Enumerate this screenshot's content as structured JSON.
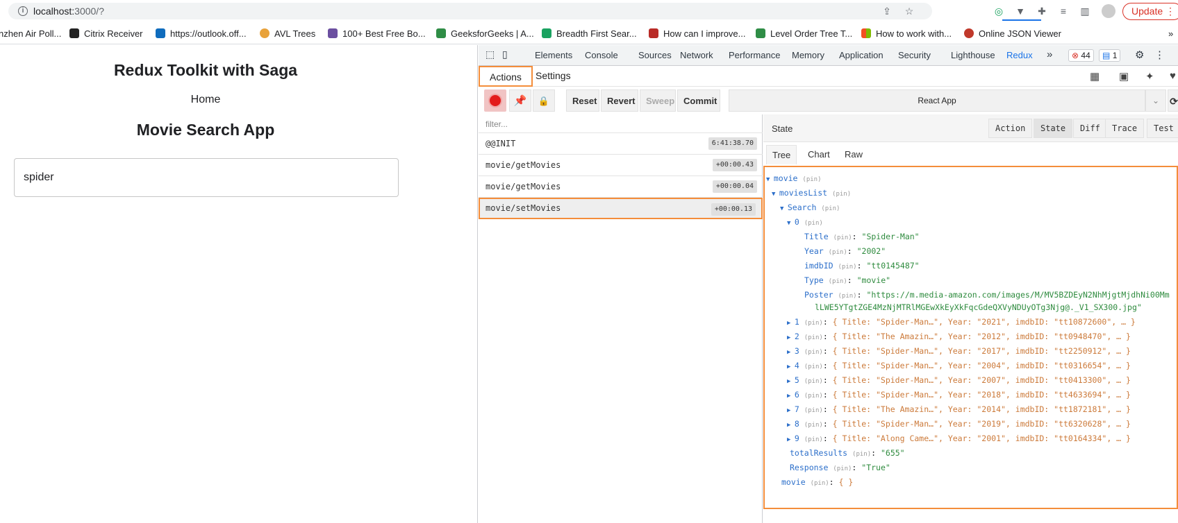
{
  "browser": {
    "url_host": "localhost:",
    "url_rest": "3000/?",
    "update_label": "Update",
    "bookmarks": [
      {
        "label": "nzhen Air Poll...",
        "color": "#ffffff"
      },
      {
        "label": "Citrix Receiver",
        "color": "#222222"
      },
      {
        "label": "https://outlook.off...",
        "color": "#0f6cbd"
      },
      {
        "label": "AVL Trees",
        "color": "#e8a23a"
      },
      {
        "label": "100+ Best Free Bo...",
        "color": "#6b4fa0"
      },
      {
        "label": "GeeksforGeeks | A...",
        "color": "#2f8d46"
      },
      {
        "label": "Breadth First Sear...",
        "color": "#1aa260"
      },
      {
        "label": "How can I improve...",
        "color": "#b92b27"
      },
      {
        "label": "Level Order Tree T...",
        "color": "#2f8d46"
      },
      {
        "label": "How to work with...",
        "color": "#f25022"
      },
      {
        "label": "Online JSON Viewer",
        "color": "#c0392b"
      }
    ]
  },
  "app": {
    "title": "Redux Toolkit with Saga",
    "home_link": "Home",
    "subtitle": "Movie Search App",
    "search_value": "spider"
  },
  "devtools": {
    "tabs": [
      "Elements",
      "Console",
      "Sources",
      "Network",
      "Performance",
      "Memory",
      "Application",
      "Security",
      "Lighthouse",
      "Redux"
    ],
    "active_tab": "Redux",
    "more": "»",
    "errors_count": "44",
    "messages_count": "1"
  },
  "redux": {
    "top_tabs": [
      "Actions",
      "Settings"
    ],
    "toolbar": {
      "reset": "Reset",
      "revert": "Revert",
      "sweep": "Sweep",
      "commit": "Commit",
      "instance": "React App"
    },
    "filter_placeholder": "filter...",
    "actions": [
      {
        "type": "@@INIT",
        "time": "6:41:38.70"
      },
      {
        "type": "movie/getMovies",
        "time": "+00:00.43"
      },
      {
        "type": "movie/getMovies",
        "time": "+00:00.04"
      },
      {
        "type": "movie/setMovies",
        "time": "+00:00.13"
      }
    ],
    "monitor": {
      "header": "State",
      "buttons": [
        "Action",
        "State",
        "Diff",
        "Trace",
        "Test"
      ],
      "active_button": "State",
      "sub_tabs": [
        "Tree",
        "Chart",
        "Raw"
      ],
      "active_sub_tab": "Tree",
      "pin_label": "(pin)",
      "tree": {
        "movie_key": "movie",
        "movies_list_key": "moviesList",
        "search_key": "Search",
        "item0_key": "0",
        "item0": [
          {
            "key": "Title",
            "value": "\"Spider-Man\""
          },
          {
            "key": "Year",
            "value": "\"2002\""
          },
          {
            "key": "imdbID",
            "value": "\"tt0145487\""
          },
          {
            "key": "Type",
            "value": "\"movie\""
          },
          {
            "key": "Poster",
            "value": "\"https://m.media-amazon.com/images/M/MV5BZDEyN2NhMjgtMjdhNi00Mm"
          }
        ],
        "poster_continuation": "lLWE5YTgtZGE4MzNjMTRlMGEwXkEyXkFqcGdeQXVyNDUyOTg3Njg@._V1_SX300.jpg\"",
        "collapsed_items": [
          {
            "key": "1",
            "summary": "{ Title: \"Spider-Man…\", Year: \"2021\", imdbID: \"tt10872600\", … }"
          },
          {
            "key": "2",
            "summary": "{ Title: \"The Amazin…\", Year: \"2012\", imdbID: \"tt0948470\", … }"
          },
          {
            "key": "3",
            "summary": "{ Title: \"Spider-Man…\", Year: \"2017\", imdbID: \"tt2250912\", … }"
          },
          {
            "key": "4",
            "summary": "{ Title: \"Spider-Man…\", Year: \"2004\", imdbID: \"tt0316654\", … }"
          },
          {
            "key": "5",
            "summary": "{ Title: \"Spider-Man…\", Year: \"2007\", imdbID: \"tt0413300\", … }"
          },
          {
            "key": "6",
            "summary": "{ Title: \"Spider-Man…\", Year: \"2018\", imdbID: \"tt4633694\", … }"
          },
          {
            "key": "7",
            "summary": "{ Title: \"The Amazin…\", Year: \"2014\", imdbID: \"tt1872181\", … }"
          },
          {
            "key": "8",
            "summary": "{ Title: \"Spider-Man…\", Year: \"2019\", imdbID: \"tt6320628\", … }"
          },
          {
            "key": "9",
            "summary": "{ Title: \"Along Came…\", Year: \"2001\", imdbID: \"tt0164334\", … }"
          }
        ],
        "total_results_key": "totalResults",
        "total_results_value": "\"655\"",
        "response_key": "Response",
        "response_value": "\"True\"",
        "movie_inner_key": "movie",
        "movie_inner_value": "{ }"
      }
    }
  }
}
